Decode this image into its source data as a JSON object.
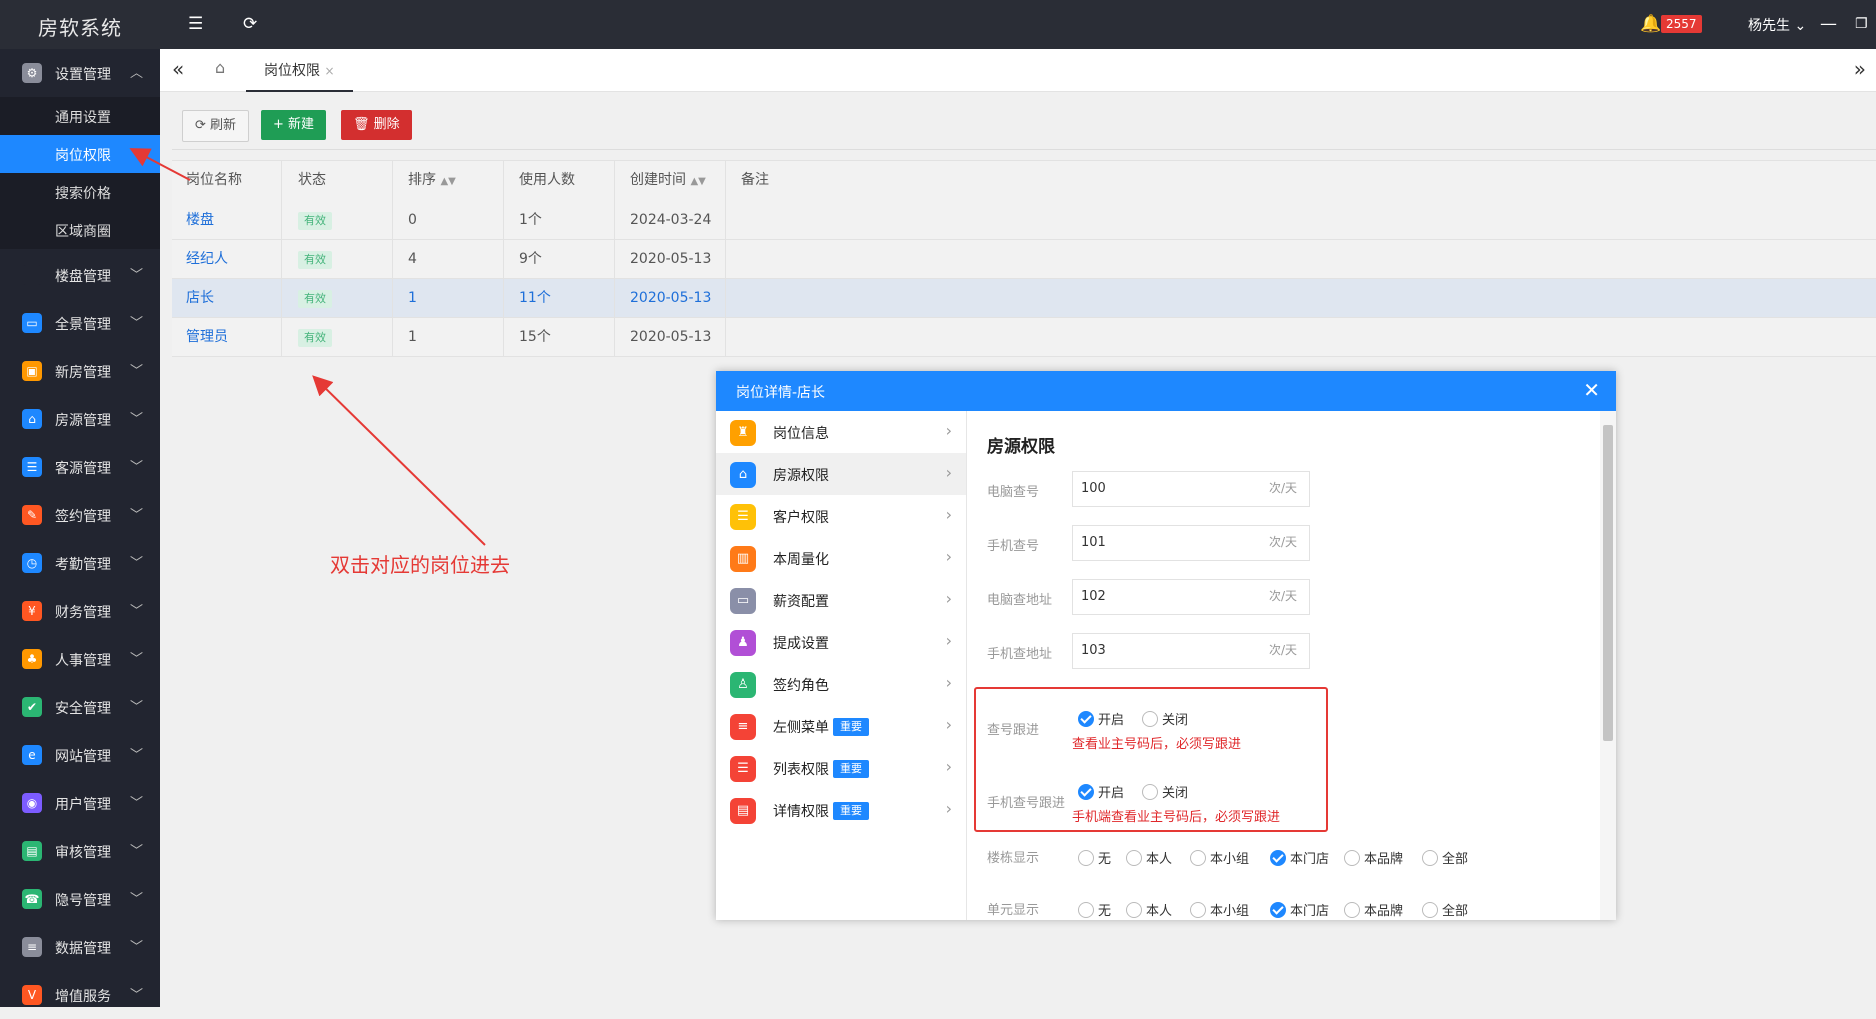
{
  "app": {
    "title": "房软系统",
    "badge": "2557",
    "user": "杨先生"
  },
  "sidebar": {
    "groups": [
      {
        "label": "设置管理",
        "icon": "gear-icon",
        "color": "#8a8d9a",
        "expanded": true
      },
      {
        "label": "楼盘管理",
        "icon": "building-icon",
        "color": "#222530"
      },
      {
        "label": "全景管理",
        "icon": "panorama-icon",
        "color": "#1e88ff"
      },
      {
        "label": "新房管理",
        "icon": "house-new-icon",
        "color": "#ff9800"
      },
      {
        "label": "房源管理",
        "icon": "home-icon",
        "color": "#1e88ff"
      },
      {
        "label": "客源管理",
        "icon": "contact-icon",
        "color": "#1e88ff"
      },
      {
        "label": "签约管理",
        "icon": "contract-icon",
        "color": "#ff5722"
      },
      {
        "label": "考勤管理",
        "icon": "clock-icon",
        "color": "#1e88ff"
      },
      {
        "label": "财务管理",
        "icon": "finance-icon",
        "color": "#ff5722"
      },
      {
        "label": "人事管理",
        "icon": "people-icon",
        "color": "#ff9800"
      },
      {
        "label": "安全管理",
        "icon": "shield-icon",
        "color": "#2bb673"
      },
      {
        "label": "网站管理",
        "icon": "ie-icon",
        "color": "#1e88ff"
      },
      {
        "label": "用户管理",
        "icon": "user-icon",
        "color": "#7c5cff"
      },
      {
        "label": "审核管理",
        "icon": "audit-icon",
        "color": "#2bb673"
      },
      {
        "label": "隐号管理",
        "icon": "phone-icon",
        "color": "#2bb673"
      },
      {
        "label": "数据管理",
        "icon": "database-icon",
        "color": "#8a8d9a"
      },
      {
        "label": "增值服务",
        "icon": "v-icon",
        "color": "#ff5722"
      }
    ],
    "subitems": [
      "通用设置",
      "岗位权限",
      "搜索价格",
      "区域商圈"
    ],
    "active_sub": "岗位权限"
  },
  "tabs": {
    "active": "岗位权限"
  },
  "toolbar": {
    "refresh": "刷新",
    "new": "新建",
    "delete": "删除"
  },
  "table": {
    "headers": [
      "岗位名称",
      "状态",
      "排序",
      "使用人数",
      "创建时间",
      "备注"
    ],
    "rows": [
      {
        "name": "楼盘",
        "status": "有效",
        "order": "0",
        "count": "1个",
        "created": "2024-03-24"
      },
      {
        "name": "经纪人",
        "status": "有效",
        "order": "4",
        "count": "9个",
        "created": "2020-05-13"
      },
      {
        "name": "店长",
        "status": "有效",
        "order": "1",
        "count": "11个",
        "created": "2020-05-13"
      },
      {
        "name": "管理员",
        "status": "有效",
        "order": "1",
        "count": "15个",
        "created": "2020-05-13"
      }
    ]
  },
  "annotation": {
    "text": "双击对应的岗位进去"
  },
  "modal": {
    "title": "岗位详情-店长",
    "menu": [
      {
        "label": "岗位信息",
        "icon": "vase-icon",
        "color": "#ffa000"
      },
      {
        "label": "房源权限",
        "icon": "home-icon",
        "color": "#1e88ff"
      },
      {
        "label": "客户权限",
        "icon": "contact-icon",
        "color": "#ffc107"
      },
      {
        "label": "本周量化",
        "icon": "chart-icon",
        "color": "#ff7a18"
      },
      {
        "label": "薪资配置",
        "icon": "wallet-icon",
        "color": "#8a8fa8"
      },
      {
        "label": "提成设置",
        "icon": "person-coin-icon",
        "color": "#b14fd6"
      },
      {
        "label": "签约角色",
        "icon": "person-check-icon",
        "color": "#2bb673"
      },
      {
        "label": "左侧菜单",
        "icon": "list-icon",
        "color": "#f44336",
        "tag": "重要"
      },
      {
        "label": "列表权限",
        "icon": "list-alt-icon",
        "color": "#f44336",
        "tag": "重要"
      },
      {
        "label": "详情权限",
        "icon": "doc-icon",
        "color": "#f44336",
        "tag": "重要"
      }
    ],
    "section_title": "房源权限",
    "fields": [
      {
        "label": "电脑查号",
        "value": "100",
        "unit": "次/天"
      },
      {
        "label": "手机查号",
        "value": "101",
        "unit": "次/天"
      },
      {
        "label": "电脑查地址",
        "value": "102",
        "unit": "次/天"
      },
      {
        "label": "手机查地址",
        "value": "103",
        "unit": "次/天"
      }
    ],
    "follow": [
      {
        "label": "查号跟进",
        "on": "开启",
        "off": "关闭",
        "hint": "查看业主号码后，必须写跟进"
      },
      {
        "label": "手机查号跟进",
        "on": "开启",
        "off": "关闭",
        "hint": "手机端查看业主号码后，必须写跟进"
      }
    ],
    "scope_options": [
      "无",
      "本人",
      "本小组",
      "本门店",
      "本品牌",
      "全部"
    ],
    "scopes": [
      {
        "label": "楼栋显示",
        "selected": "本门店"
      },
      {
        "label": "单元显示",
        "selected": "本门店"
      }
    ]
  }
}
